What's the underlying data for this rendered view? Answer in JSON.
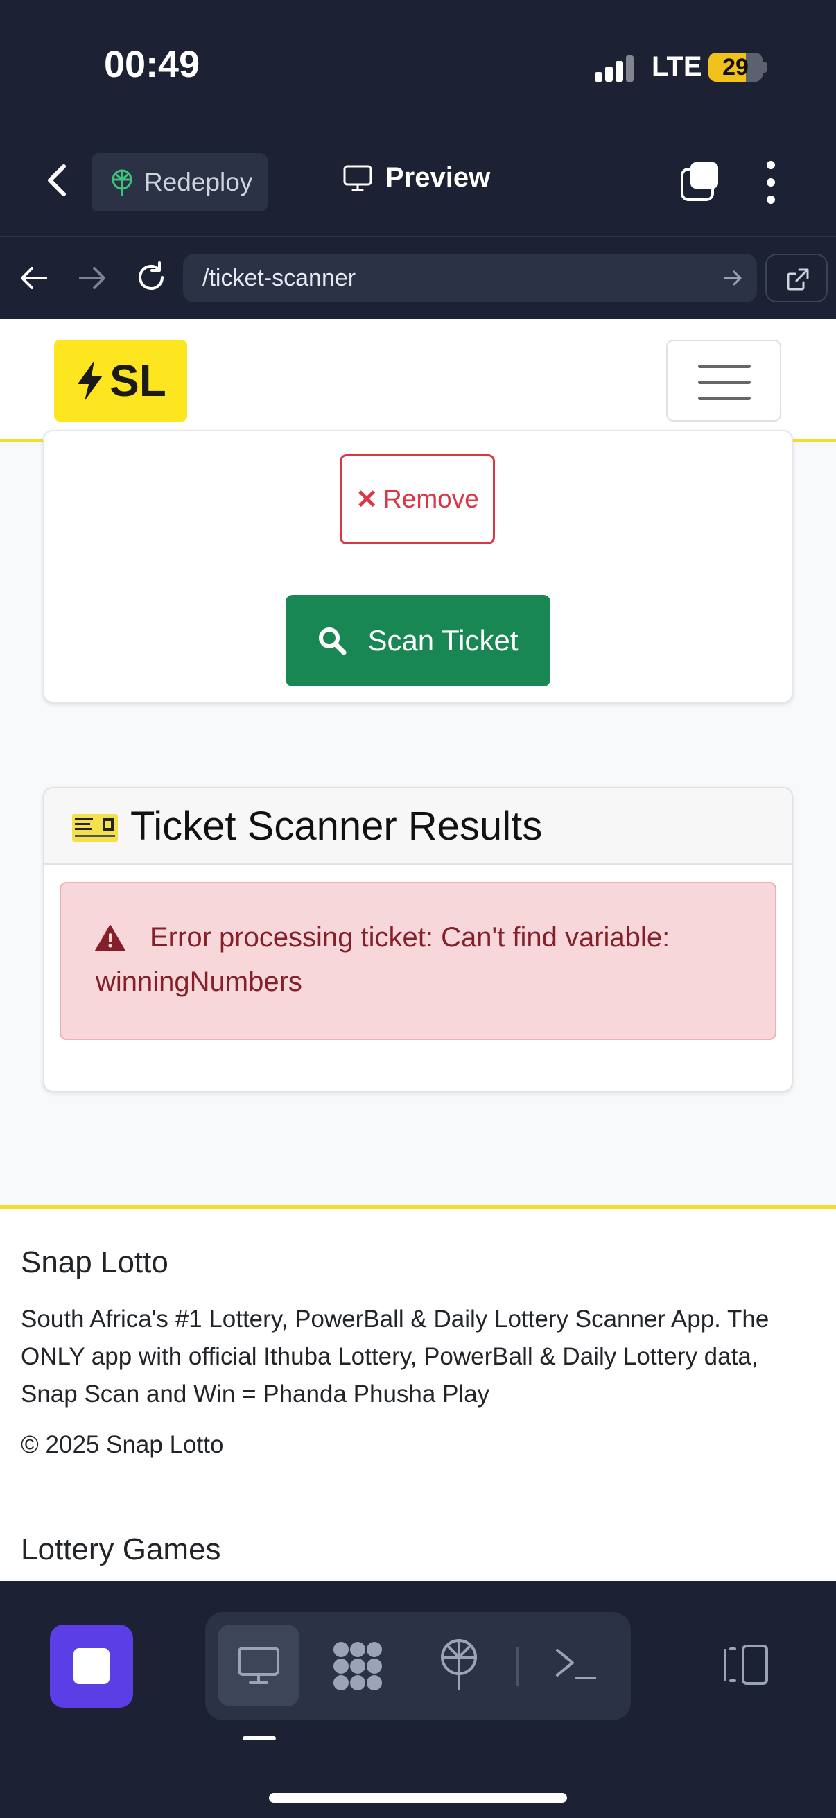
{
  "status_bar": {
    "time": "00:49",
    "network": "LTE",
    "battery": "29"
  },
  "replit_header": {
    "redeploy_label": "Redeploy",
    "preview_label": "Preview"
  },
  "browser": {
    "url": "/ticket-scanner"
  },
  "navbar": {
    "brand": "SL",
    "brand_color": "#fde51f",
    "accent_color": "#f6dd2b"
  },
  "scanner_card": {
    "remove_label": "Remove",
    "scan_label": "Scan Ticket",
    "scan_color": "#198754",
    "remove_color": "#dc3545"
  },
  "results": {
    "title": "Ticket Scanner Results",
    "error_text": "Error processing ticket: Can't find variable: winningNumbers",
    "error_bg": "#f8d7da",
    "error_fg": "#842029"
  },
  "footer": {
    "title": "Snap Lotto",
    "description": "South Africa's #1 Lottery, PowerBall & Daily Lottery Scanner App. The ONLY app with official Ithuba Lottery, PowerBall & Daily Lottery data, Snap Scan and Win = Phanda Phusha Play",
    "copyright": "© 2025 Snap Lotto",
    "games_heading": "Lottery Games"
  },
  "bottom_toolbar": {
    "stop_color": "#5b3ee6",
    "tools": [
      "preview-icon",
      "apps-icon",
      "deploy-icon",
      "shell-icon",
      "layout-icon"
    ]
  }
}
